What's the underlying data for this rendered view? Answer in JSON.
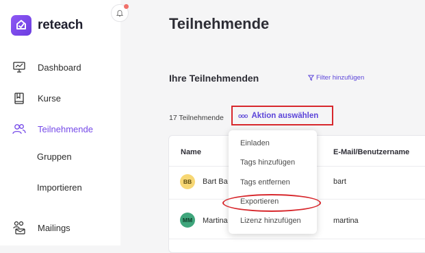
{
  "app": {
    "name": "reteach"
  },
  "sidebar": {
    "items": [
      {
        "label": "Dashboard",
        "icon": "monitor-chart-icon",
        "active": false
      },
      {
        "label": "Kurse",
        "icon": "book-icon",
        "active": false
      },
      {
        "label": "Teilnehmende",
        "icon": "users-icon",
        "active": true
      },
      {
        "label": "Mailings",
        "icon": "mail-users-icon",
        "active": false
      }
    ],
    "subitems": [
      {
        "label": "Gruppen"
      },
      {
        "label": "Importieren"
      }
    ]
  },
  "page": {
    "title": "Teilnehmende"
  },
  "section": {
    "title": "Ihre Teilnehmenden",
    "filter_label": "Filter hinzufügen"
  },
  "toolbar": {
    "count_text": "17 Teilnehmende",
    "action_label": "Aktion auswählen"
  },
  "table": {
    "headers": {
      "name": "Name",
      "email": "E-Mail/Benutzername"
    },
    "rows": [
      {
        "initials": "BB",
        "name": "Bart Ba",
        "email": "bart",
        "avatar_color": "#f7d774"
      },
      {
        "initials": "MM",
        "name": "Martina",
        "email": "martina",
        "avatar_color": "#3fa67c"
      }
    ]
  },
  "dropdown": {
    "items": [
      {
        "label": "Einladen"
      },
      {
        "label": "Tags hinzufügen"
      },
      {
        "label": "Tags entfernen"
      },
      {
        "label": "Exportieren"
      },
      {
        "label": "Lizenz hinzufügen"
      }
    ]
  },
  "colors": {
    "accent": "#7448e8",
    "link": "#5b44d9",
    "highlight": "#d7262b"
  }
}
